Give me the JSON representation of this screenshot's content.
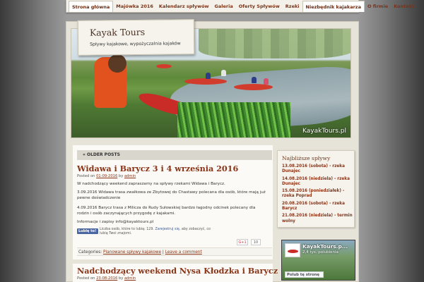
{
  "nav": {
    "items": [
      {
        "label": "Strona główna",
        "active": true
      },
      {
        "label": "Majówka 2016"
      },
      {
        "label": "Kalendarz spływów"
      },
      {
        "label": "Galeria"
      },
      {
        "label": "Oferty Spływów"
      },
      {
        "label": "Rzeki"
      },
      {
        "label": "Niezbędnik kajakarza"
      },
      {
        "label": "O firmie"
      },
      {
        "label": "Kontakt"
      }
    ]
  },
  "site": {
    "title": "Kayak Tours",
    "tagline": "Spływy kajakowe, wypożyczalnia kajaków",
    "watermark": "KayakTours.pl"
  },
  "main": {
    "older_posts": "« OLDER POSTS",
    "post1": {
      "title": "Widawa i Barycz 3 i 4 września 2016",
      "meta_prefix": "Posted on",
      "date": "01-09-2016",
      "meta_by": "by",
      "author": "admin",
      "p1": "W nadchodzący weekend zapraszamy na spływy rzekami Widawa i Barycz.",
      "p2": "3.09.2016 Widawa trasa zwałkowa ze Zbytowej do Chastawy polecana dla osób, które mają już pewne doświadczenie",
      "p3": "4.09.2016 Barycz trasa z Milicza do Rudy Sułowskiej bardzo łagodny  odcinek polecany dla rodzin i osób zaczynających przygodę z kajakami.",
      "p4": "Informacje i zapisy info@kayaktours.pl",
      "fb_like": "Lubię to!",
      "fb_text_a": "Liczba osób, które to lubią: 129.",
      "fb_text_link": "Zarejestruj się,",
      "fb_text_b": "aby zobaczyć, co lubią Twoi znajomi.",
      "gplus": "G+1",
      "gplus_count": "10",
      "categories_label": "Categories:",
      "category": "Planowane spływy kajakowe",
      "separator": "|",
      "comment": "Leave a comment"
    },
    "post2": {
      "title": "Nadchodzący weekend Nysa Kłodzka i Barycz",
      "meta_prefix": "Posted on",
      "date": "23-08-2016",
      "meta_by": "by",
      "author": "admin"
    }
  },
  "sidebar": {
    "title": "Najbliższe spływy",
    "items": [
      "13.08.2016 (sobota) - rzeka Dunajec",
      "14.08.2016 (niedziela) - rzeka Dunajec",
      "15.08.2016 (poniedziałek) - rzeka Poprad",
      "20.08.2016 (sobota) - rzeka Barycz",
      "21.08.2016 (niedziela) - termin wolny"
    ],
    "fb": {
      "name": "KayakTours.p...",
      "likes": "2,4 tys. polubienia",
      "button": "Polub tę stronę"
    }
  }
}
